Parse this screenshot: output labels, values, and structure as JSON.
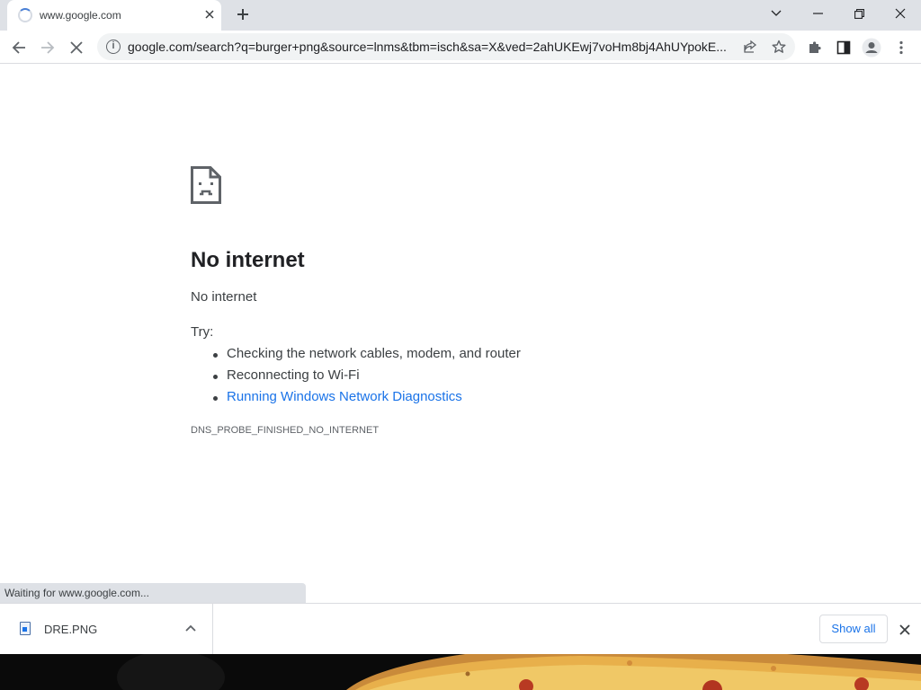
{
  "tab": {
    "title": "www.google.com",
    "close_icon": "close-icon",
    "loading_icon": "spinner-icon"
  },
  "tabstrip": {
    "new_tab_icon": "plus-icon",
    "search_tabs_icon": "chevron-down-icon"
  },
  "window_controls": {
    "minimize_icon": "minimize-icon",
    "restore_icon": "restore-icon",
    "close_icon": "close-icon"
  },
  "toolbar": {
    "back_icon": "back-arrow-icon",
    "forward_icon": "forward-arrow-icon",
    "stop_icon": "stop-icon",
    "url": "google.com/search?q=burger+png&source=lnms&tbm=isch&sa=X&ved=2ahUKEwj7voHm8bj4AhUYpokE...",
    "site_info_icon": "info-icon",
    "share_icon": "share-icon",
    "bookmark_icon": "star-icon",
    "extensions_icon": "puzzle-icon",
    "side_panel_icon": "side-panel-icon",
    "profile_icon": "profile-icon",
    "menu_icon": "kebab-menu-icon"
  },
  "error_page": {
    "icon": "sad-document-icon",
    "title": "No internet",
    "subtitle": "No internet",
    "try_label": "Try:",
    "suggestions": [
      "Checking the network cables, modem, and router",
      "Reconnecting to Wi-Fi",
      "Running Windows Network Diagnostics"
    ],
    "error_code": "DNS_PROBE_FINISHED_NO_INTERNET"
  },
  "status_bar": {
    "text": "Waiting for www.google.com..."
  },
  "download_shelf": {
    "item": {
      "filename": "DRE.PNG",
      "file_icon": "image-file-icon",
      "chevron_icon": "chevron-up-icon"
    },
    "show_all_label": "Show all",
    "close_icon": "close-icon"
  },
  "colors": {
    "accent": "#1a73e8",
    "tabstrip": "#dee1e6",
    "text": "#202124"
  }
}
